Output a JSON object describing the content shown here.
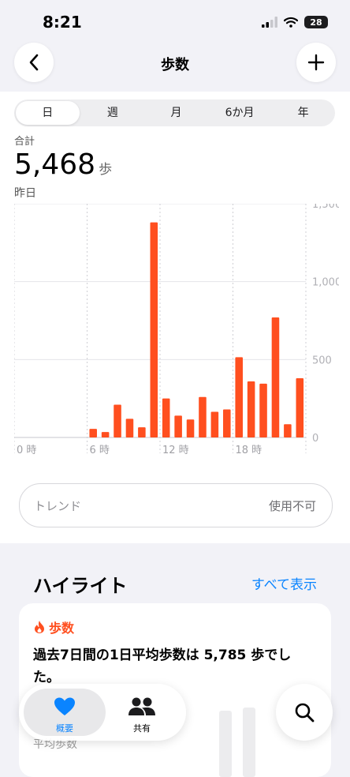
{
  "status": {
    "time": "8:21",
    "battery": "28"
  },
  "nav": {
    "title": "歩数"
  },
  "segments": [
    "日",
    "週",
    "月",
    "6か月",
    "年"
  ],
  "summary": {
    "label": "合計",
    "value": "5,468",
    "unit": "歩",
    "date": "昨日"
  },
  "chart_data": {
    "type": "bar",
    "hours": [
      0,
      1,
      2,
      3,
      4,
      5,
      6,
      7,
      8,
      9,
      10,
      11,
      12,
      13,
      14,
      15,
      16,
      17,
      18,
      19,
      20,
      21,
      22,
      23
    ],
    "values": [
      0,
      0,
      0,
      0,
      0,
      0,
      55,
      35,
      210,
      120,
      65,
      1380,
      250,
      140,
      115,
      260,
      165,
      180,
      515,
      360,
      345,
      770,
      85,
      380
    ],
    "ylim": [
      0,
      1500
    ],
    "yticks": [
      "1,500",
      "1,000",
      "500",
      "0"
    ],
    "xticks": [
      "0 時",
      "6 時",
      "12 時",
      "18 時"
    ],
    "color": "#ff4f1f"
  },
  "trend": {
    "label": "トレンド",
    "value": "使用不可"
  },
  "highlights": {
    "title": "ハイライト",
    "show_all": "すべて表示",
    "card": {
      "header": "歩数",
      "text": "過去7日間の1日平均歩数は 5,785 歩でした。",
      "sub": "平均歩数"
    }
  },
  "tabbar": {
    "summary": "概要",
    "sharing": "共有"
  }
}
